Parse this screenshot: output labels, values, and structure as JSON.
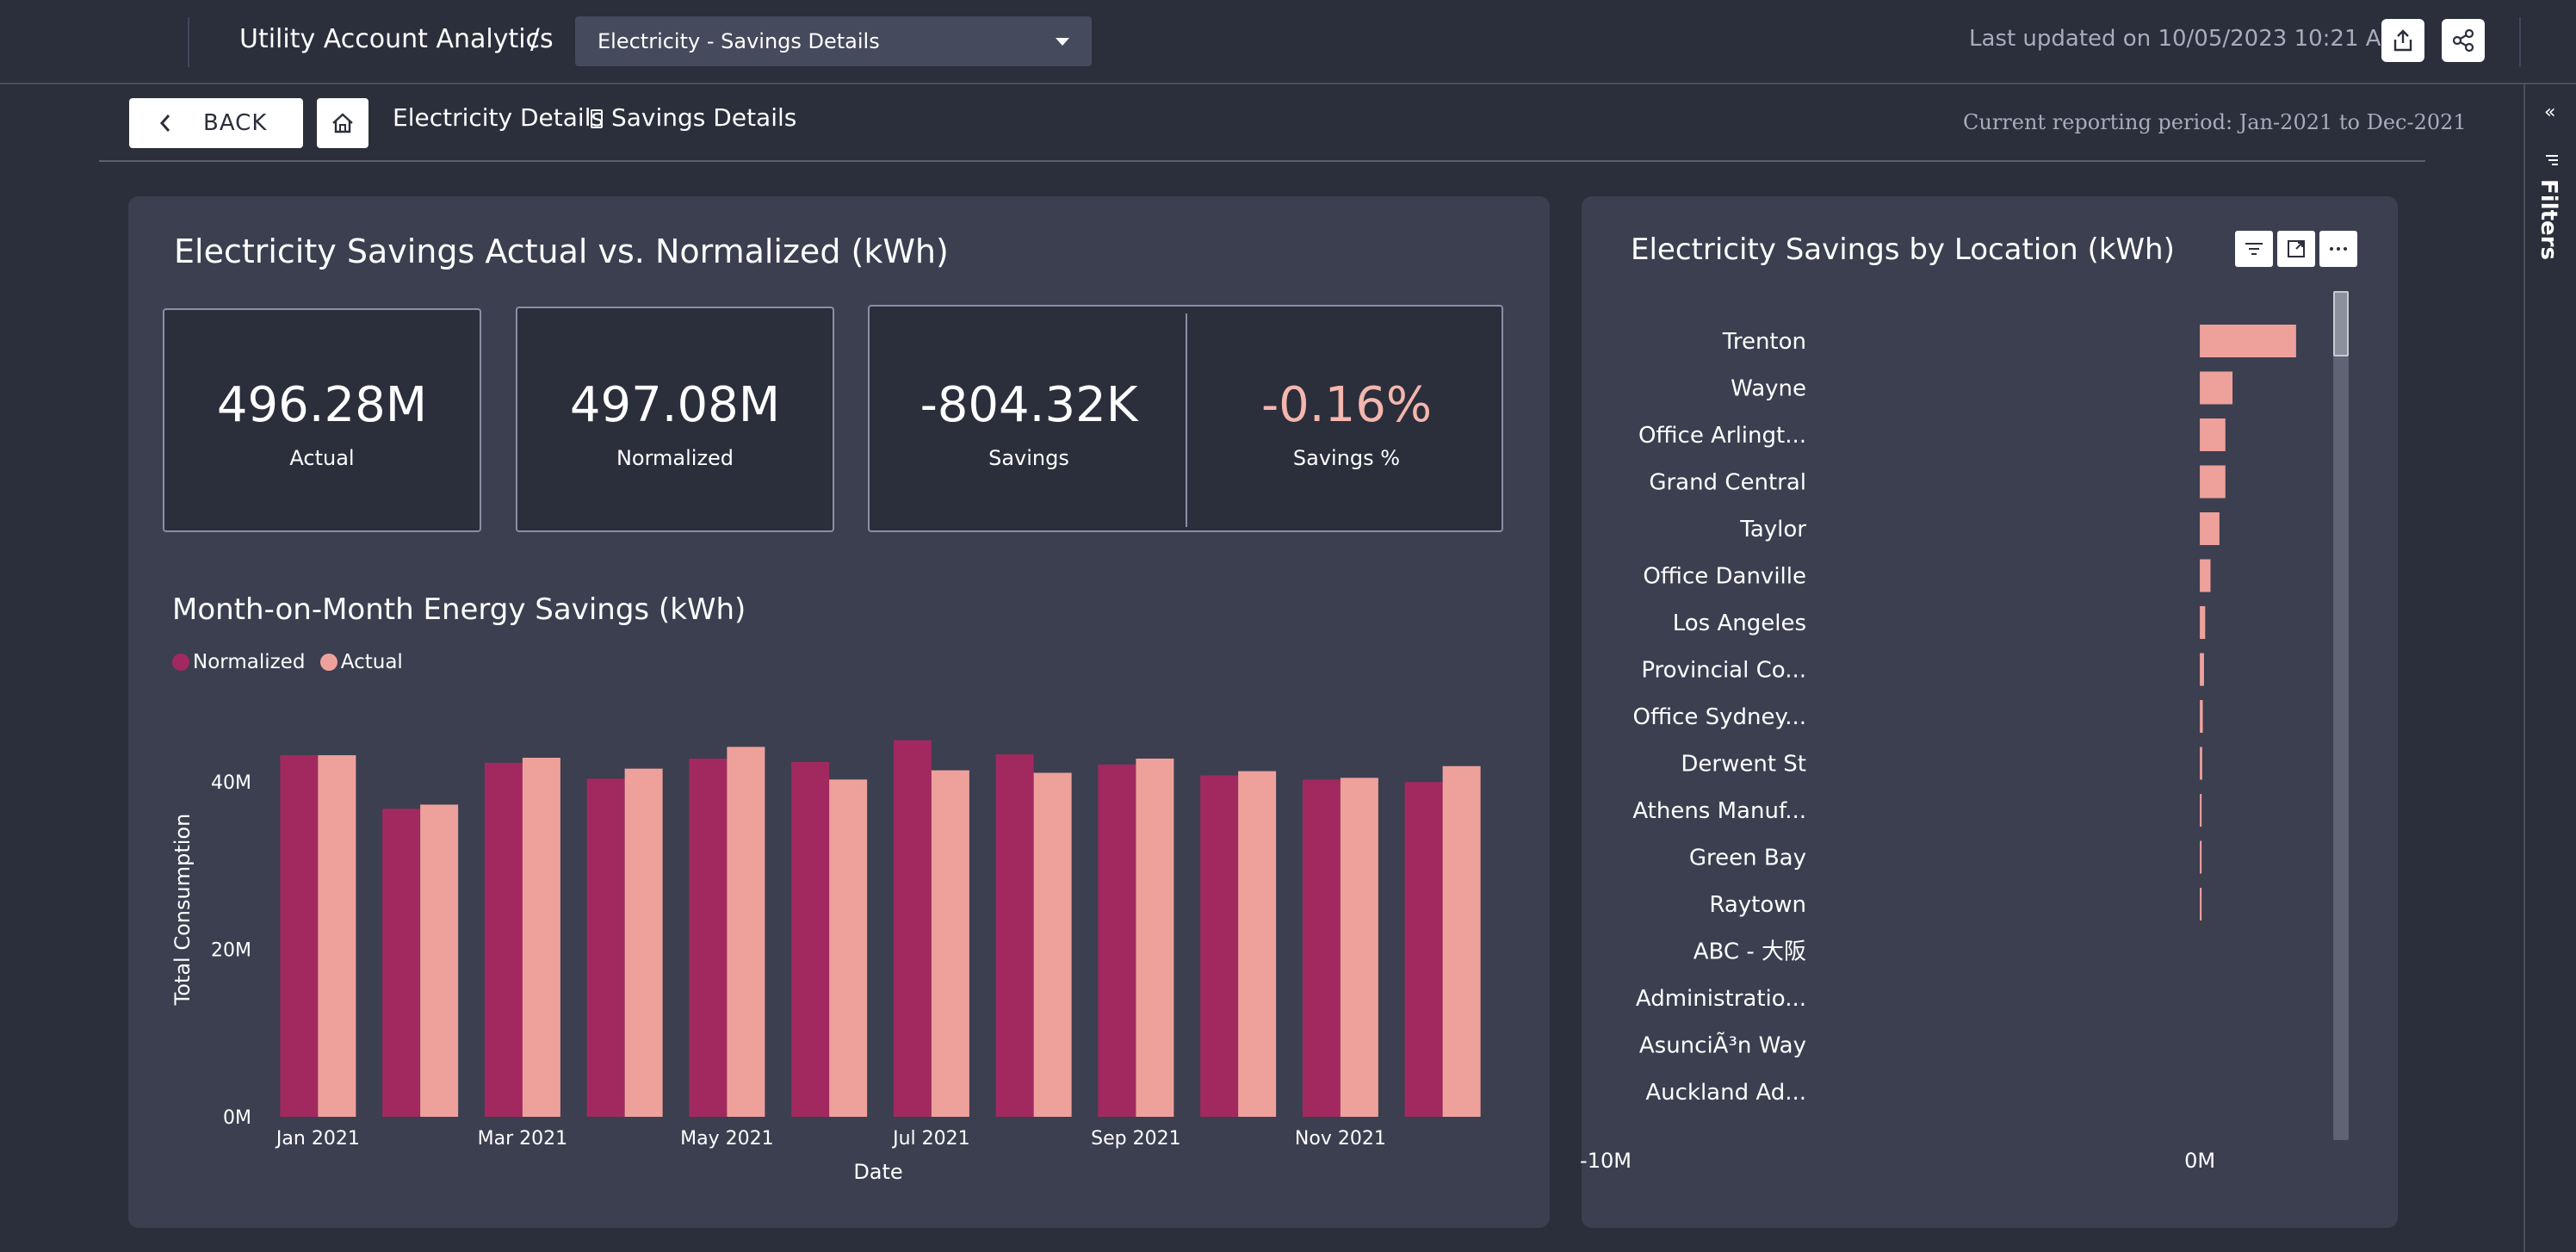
{
  "header": {
    "app_title": "Utility Account Analytics",
    "separator": "/",
    "page_select_value": "Electricity - Savings Details",
    "last_updated": "Last updated on 10/05/2023 10:21 AM",
    "export_icon": "export-icon",
    "share_icon": "share-icon"
  },
  "subheader": {
    "back_label": "BACK",
    "home_icon": "home-icon",
    "breadcrumb": [
      "Electricity Details",
      "Savings Details"
    ],
    "period": "Current reporting period: Jan-2021 to Dec-2021"
  },
  "filters_rail": {
    "label": "Filters",
    "collapse_icon": "double-chevron-left-icon",
    "collapse_glyph": "«",
    "filter_icon": "filter-icon"
  },
  "savings_panel": {
    "title": "Electricity Savings Actual vs. Normalized (kWh)",
    "kpis": [
      {
        "value": "496.28M",
        "label": "Actual"
      },
      {
        "value": "497.08M",
        "label": "Normalized"
      },
      {
        "value": "-804.32K",
        "label": "Savings"
      },
      {
        "value": "-0.16%",
        "label": "Savings %"
      }
    ],
    "mom_title": "Month-on-Month Energy Savings (kWh)"
  },
  "location_panel": {
    "title": "Electricity Savings by Location (kWh)",
    "tool_icons": [
      "filter-lines-icon",
      "expand-icon",
      "more-options-icon"
    ]
  },
  "colors": {
    "normalized": "#a2295f",
    "actual": "#eea19b",
    "kpi_negative_percent": "#f4b6ad",
    "panel_bg": "#3b3f50",
    "page_bg": "#2b2e3b"
  },
  "chart_data": [
    {
      "type": "bar",
      "title": "Month-on-Month Energy Savings (kWh)",
      "xlabel": "Date",
      "ylabel": "Total Consumption",
      "categories": [
        "Jan 2021",
        "Feb 2021",
        "Mar 2021",
        "Apr 2021",
        "May 2021",
        "Jun 2021",
        "Jul 2021",
        "Aug 2021",
        "Sep 2021",
        "Oct 2021",
        "Nov 2021",
        "Dec 2021"
      ],
      "x_tick_labels": [
        "Jan 2021",
        "",
        "Mar 2021",
        "",
        "May 2021",
        "",
        "Jul 2021",
        "",
        "Sep 2021",
        "",
        "Nov 2021",
        ""
      ],
      "series": [
        {
          "name": "Normalized",
          "values": [
            43.2,
            36.8,
            42.3,
            40.4,
            42.8,
            42.4,
            45.0,
            43.3,
            42.1,
            40.8,
            40.3,
            40.0
          ]
        },
        {
          "name": "Actual",
          "values": [
            43.2,
            37.3,
            42.9,
            41.6,
            44.2,
            40.3,
            41.4,
            41.1,
            42.8,
            41.3,
            40.5,
            41.9
          ]
        }
      ],
      "y_ticks": [
        "0M",
        "20M",
        "40M"
      ],
      "ylim": [
        0,
        50
      ],
      "legend": "top-left",
      "grid": false
    },
    {
      "type": "bar",
      "orientation": "horizontal",
      "title": "Electricity Savings by Location (kWh)",
      "categories": [
        "Trenton",
        "Wayne",
        "Office Arlingt...",
        "Grand Central",
        "Taylor",
        "Office Danville",
        "Los Angeles",
        "Provincial Co...",
        "Office Sydney...",
        "Derwent St",
        "Athens Manuf...",
        "Green Bay",
        "Raytown",
        "ABC - 大阪",
        "Administratio...",
        "AsunciÃ³n Way",
        "Auckland Ad..."
      ],
      "values": [
        1.62,
        0.55,
        0.43,
        0.43,
        0.33,
        0.18,
        0.09,
        0.07,
        0.05,
        0.04,
        0.03,
        0.03,
        0.03,
        0,
        0,
        0,
        0
      ],
      "unit": "M kWh",
      "x_ticks": [
        "-10M",
        "0M"
      ],
      "xlim": [
        -10,
        2.1
      ],
      "grid": false
    }
  ]
}
